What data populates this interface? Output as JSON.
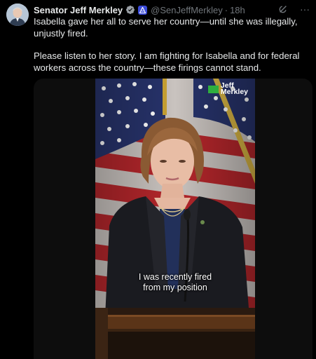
{
  "author": {
    "name": "Senator Jeff Merkley",
    "handle": "@SenJeffMerkley",
    "separator": "·",
    "time": "18h",
    "verified_icon": "verified-badge-icon",
    "gov_icon": "government-affiliation-badge-icon"
  },
  "actions": {
    "grok_icon": "grok-icon",
    "more_label": "···"
  },
  "tweet": {
    "paragraph_1": "Isabella gave her all to serve her country—until she was illegally, unjustly fired.",
    "paragraph_2": "Please listen to her story. I am fighting for Isabella and for federal workers across the country—these firings cannot stand."
  },
  "video": {
    "watermark_line_1": "Jeff",
    "watermark_line_2": "Merkley",
    "caption_line_1": "I was recently fired",
    "caption_line_2": "from my position"
  },
  "colors": {
    "background": "#000000",
    "text_primary": "#e7e9ea",
    "text_secondary": "#71767b",
    "verified_blue": "#1d9bf0",
    "gov_badge": "#3b4bd8",
    "watermark_green": "#2fae3f"
  }
}
